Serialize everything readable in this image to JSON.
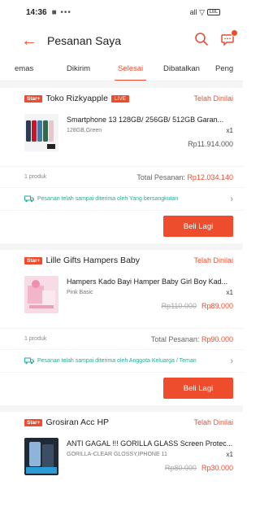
{
  "status_bar": {
    "time": "14:36",
    "dots": "■ •••",
    "signal": "all ▽",
    "battery": "LBL"
  },
  "header": {
    "title": "Pesanan Saya"
  },
  "tabs": [
    {
      "label": "emas"
    },
    {
      "label": "Dikirim"
    },
    {
      "label": "Selesai"
    },
    {
      "label": "Dibatalkan"
    },
    {
      "label": "Peng"
    }
  ],
  "colors": {
    "accent": "#ee4d2d",
    "teal": "#26aa99"
  },
  "orders": [
    {
      "badge": "Star+",
      "shop": "Toko Rizkyapple",
      "live": "LIVE",
      "status": "Telah Dinilai",
      "product_name": "Smartphone 13 128GB/ 256GB/ 512GB Garan...",
      "variant": "128GB,Green",
      "qty": "x1",
      "original_price": "",
      "price": "Rp11.914.000",
      "count": "1 produk",
      "total_label": "Total Pesanan:",
      "total": "Rp12.034.140",
      "delivery": "Pesanan telah sampai diterima oleh Yang bersangkutan",
      "button": "Beli Lagi"
    },
    {
      "badge": "Star+",
      "shop": "Lille Gifts Hampers Baby",
      "status": "Telah Dinilai",
      "product_name": "Hampers Kado Bayi Hamper Baby Girl Boy Kad...",
      "variant": "Pink Basic",
      "qty": "x1",
      "original_price": "Rp110.000",
      "price": "Rp89.000",
      "count": "1 produk",
      "total_label": "Total Pesanan:",
      "total": "Rp90.000",
      "delivery": "Pesanan telah sampai diterima oleh Anggota Keluarga / Teman",
      "button": "Beli Lagi"
    },
    {
      "badge": "Star+",
      "shop": "Grosiran Acc HP",
      "status": "Telah Dinilai",
      "product_name": "ANTI GAGAL !!! GORILLA GLASS Screen Protec...",
      "variant": "GORILLA-CLEAR GLOSSY,IPHONE 11",
      "qty": "x1",
      "original_price": "Rp80.000",
      "price": "Rp30.000"
    }
  ]
}
